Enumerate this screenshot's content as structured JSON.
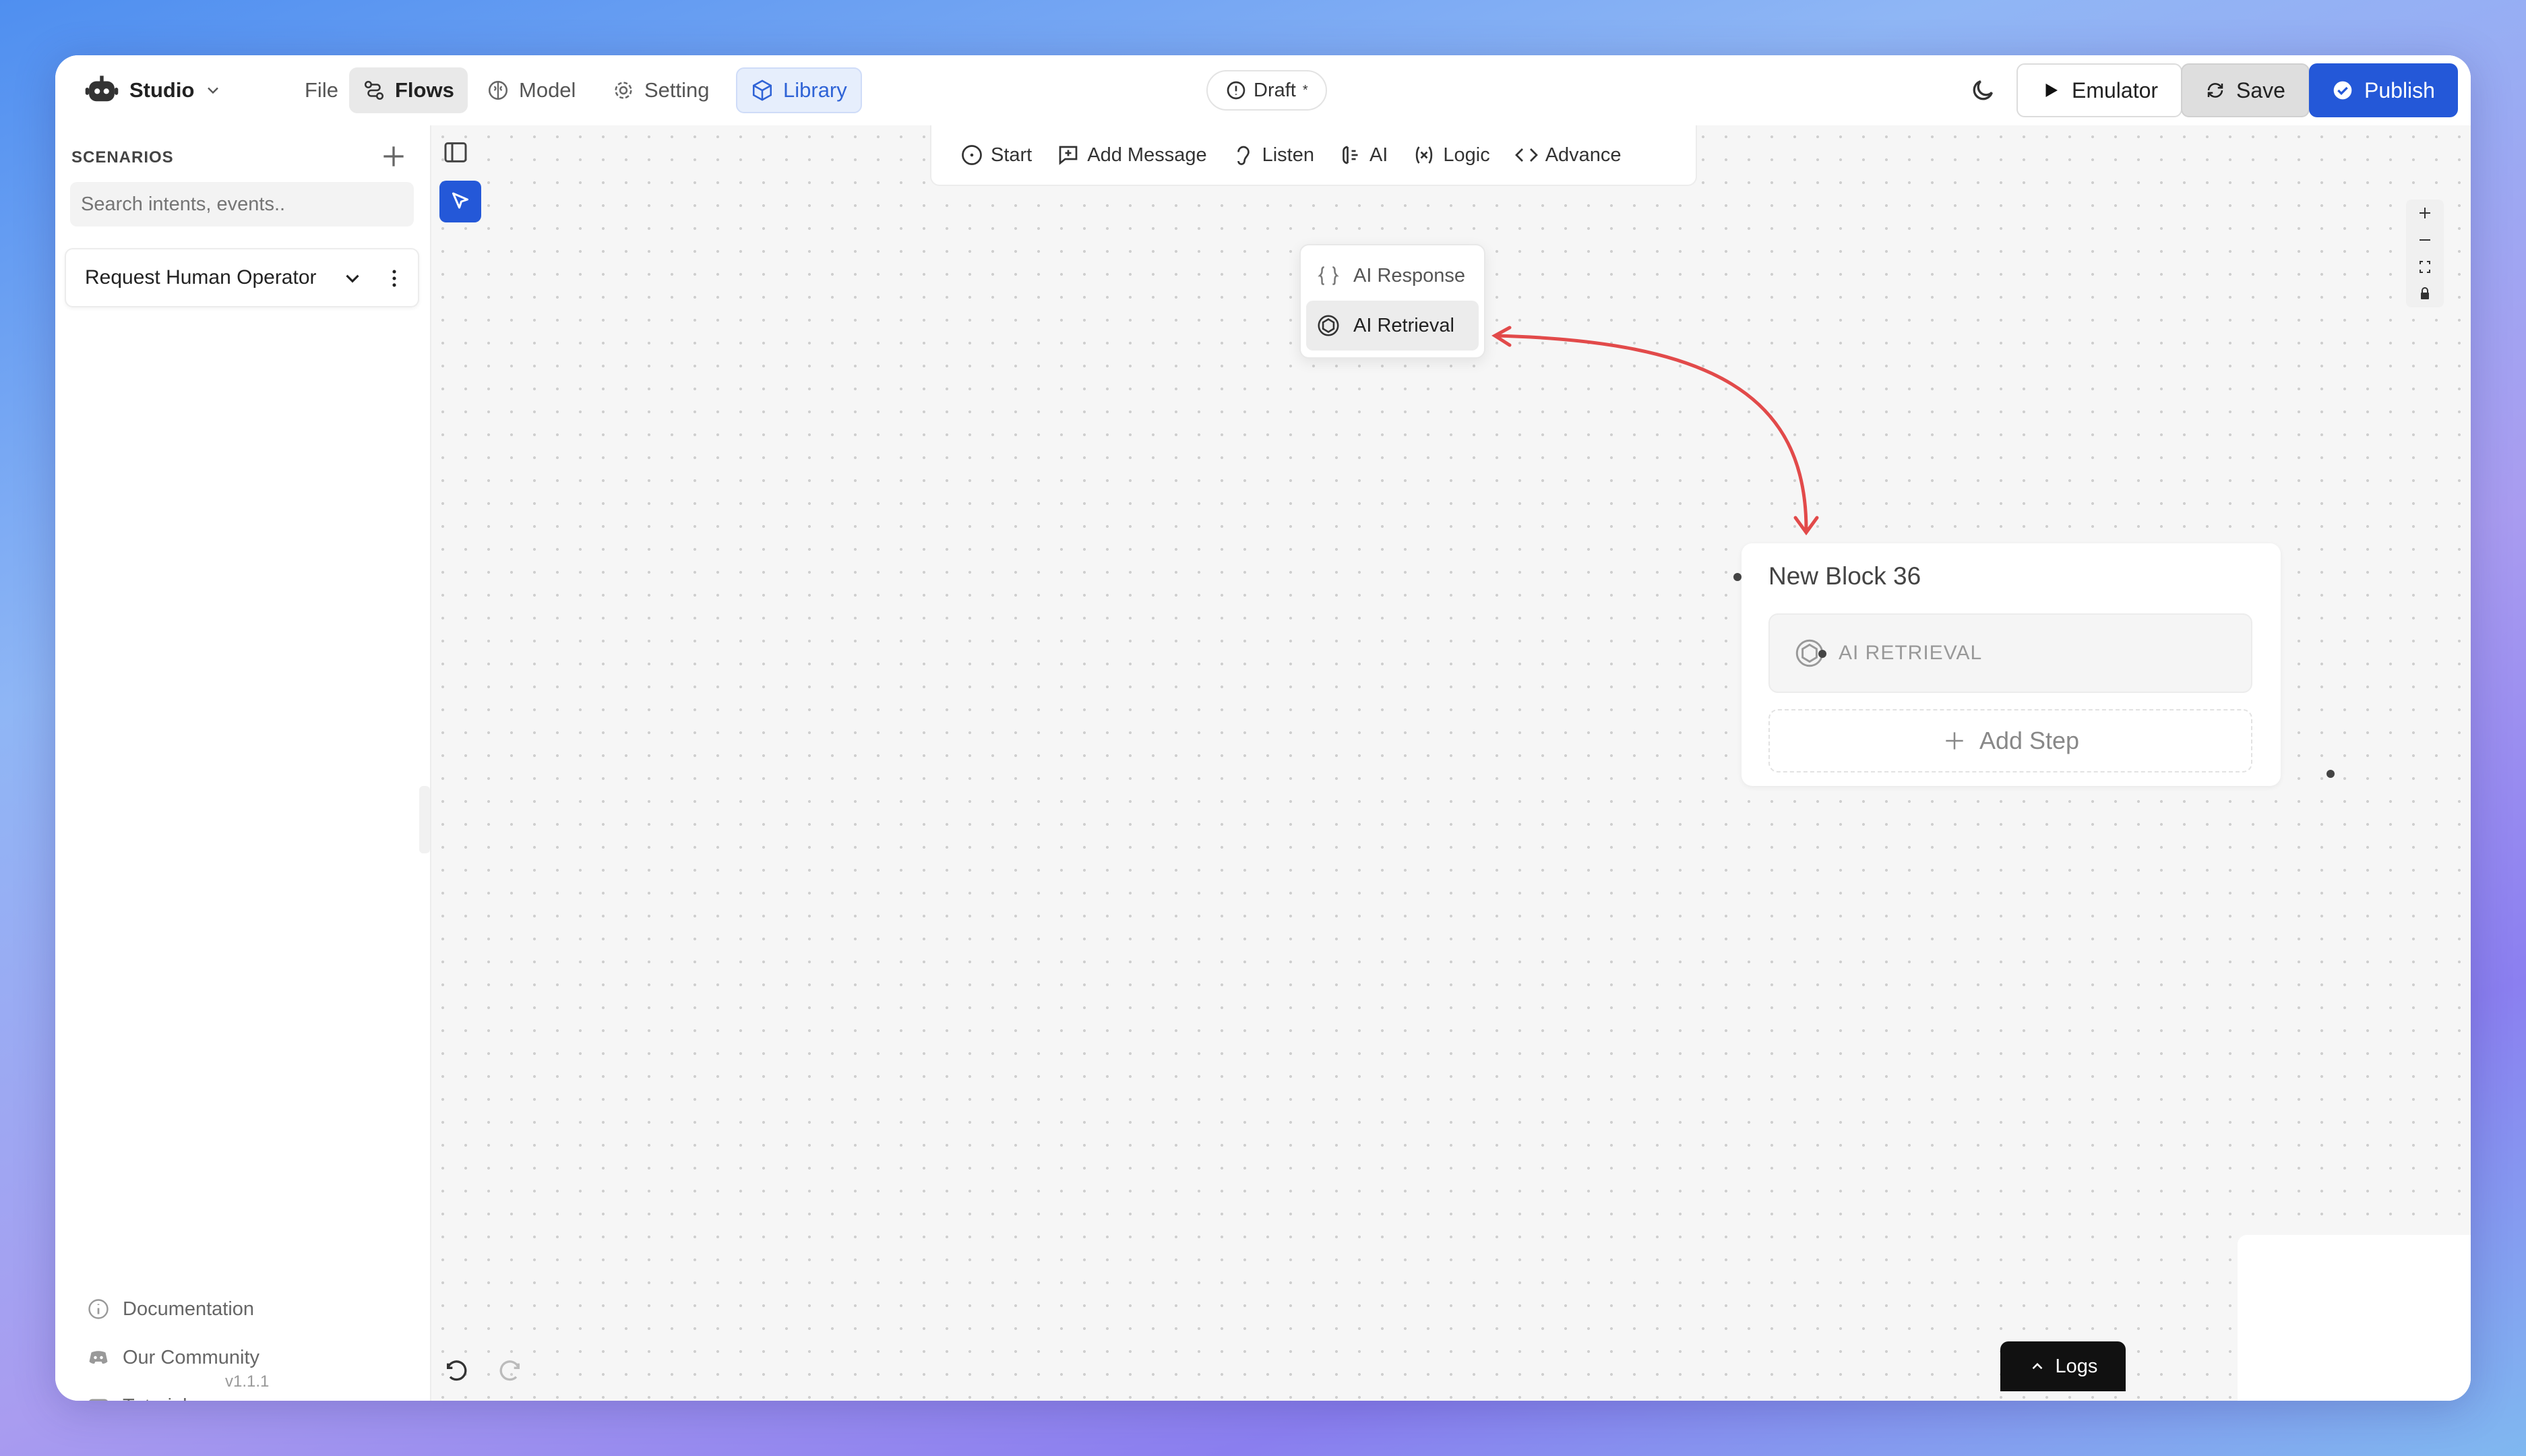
{
  "topbar": {
    "studio": "Studio",
    "file": "File",
    "flows": "Flows",
    "model": "Model",
    "setting": "Setting",
    "library": "Library",
    "draft": "Draft",
    "draft_mark": "*",
    "emulator": "Emulator",
    "save": "Save",
    "publish": "Publish"
  },
  "sidebar": {
    "title": "SCENARIOS",
    "search_placeholder": "Search intents, events..",
    "scenario": "Request Human Operator",
    "links": {
      "documentation": "Documentation",
      "community": "Our Community",
      "tutorials": "Tutorials"
    },
    "version": "v1.1.1"
  },
  "toolbar": {
    "start": "Start",
    "add_message": "Add Message",
    "listen": "Listen",
    "ai": "AI",
    "logic": "Logic",
    "advance": "Advance"
  },
  "ai_menu": {
    "response": "AI Response",
    "retrieval": "AI Retrieval"
  },
  "block": {
    "title": "New Block 36",
    "step": "AI RETRIEVAL",
    "add_step": "Add Step"
  },
  "logs": "Logs",
  "colors": {
    "accent": "#2458d8",
    "arrow": "#e24a4a"
  }
}
